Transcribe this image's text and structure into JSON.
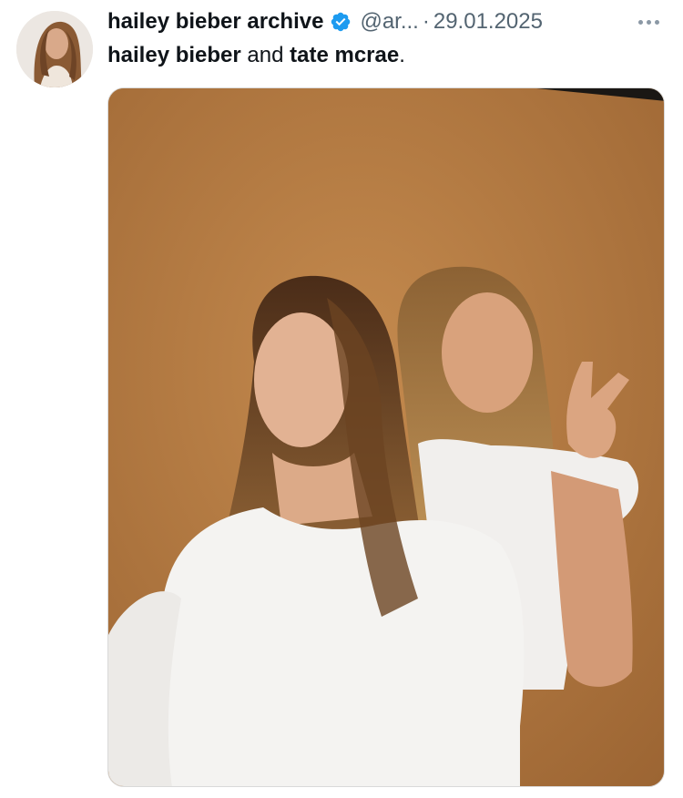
{
  "tweet": {
    "display_name": "hailey bieber archive",
    "handle": "@ar...",
    "separator": "·",
    "date": "29.01.2025",
    "text_part1": "hailey bieber",
    "text_part2": " and ",
    "text_part3": "tate mcrae",
    "text_part4": ".",
    "verified_icon": "verified-badge-icon",
    "more_icon": "more-options-icon"
  },
  "colors": {
    "text_primary": "#0f1419",
    "text_secondary": "#536471",
    "verified_blue": "#1d9bf0",
    "photo_background": "#b27a42"
  }
}
